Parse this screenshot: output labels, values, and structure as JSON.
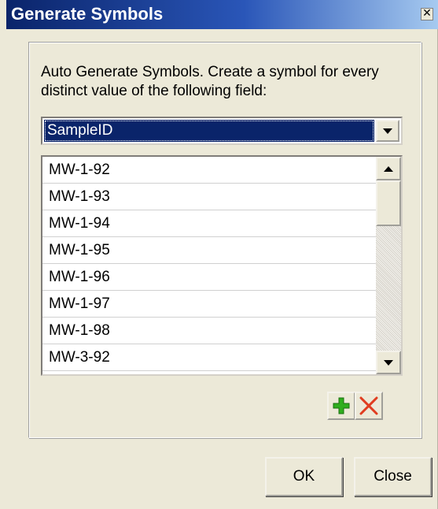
{
  "window": {
    "title": "Generate Symbols",
    "close_glyph": "✕"
  },
  "description": "Auto Generate Symbols. Create a symbol for every distinct value of the following field:",
  "field_combo": {
    "selected": "SampleID"
  },
  "values_list": {
    "items": [
      "MW-1-92",
      "MW-1-93",
      "MW-1-94",
      "MW-1-95",
      "MW-1-96",
      "MW-1-97",
      "MW-1-98",
      "MW-3-92"
    ]
  },
  "icons": {
    "add": "plus-icon",
    "remove": "x-icon",
    "add_color": "#2fae1e",
    "remove_color": "#e03c20"
  },
  "buttons": {
    "ok": "OK",
    "close": "Close"
  },
  "colors": {
    "title_bar_start": "#0a246a",
    "title_bar_end": "#a6caf0",
    "selection": "#0a246a",
    "dialog_bg": "#ece9d8"
  }
}
